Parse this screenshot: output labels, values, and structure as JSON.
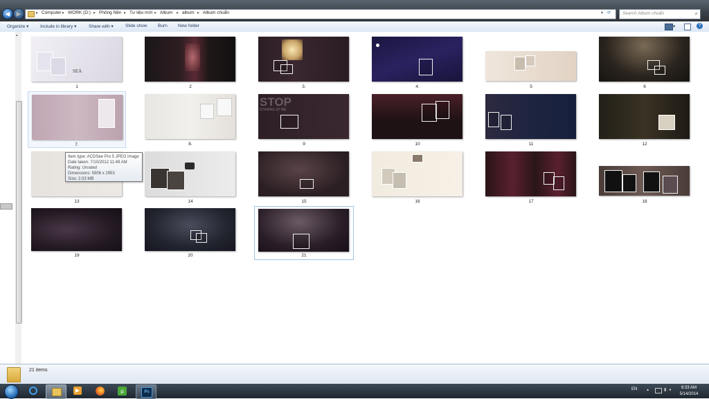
{
  "address": {
    "crumbs": [
      "Computer",
      "WORK (D:)",
      "Phông Nền",
      "Tư liệu mới",
      "Album",
      "album",
      "Album chuẩn"
    ]
  },
  "search": {
    "placeholder": "Search Album chuẩn"
  },
  "toolbar": {
    "organize": "Organize ▾",
    "include": "Include in library ▾",
    "share": "Share with ▾",
    "slideshow": "Slide show",
    "burn": "Burn",
    "newfolder": "New folder"
  },
  "files": [
    {
      "name": "1"
    },
    {
      "name": "2"
    },
    {
      "name": "3."
    },
    {
      "name": "4."
    },
    {
      "name": "5"
    },
    {
      "name": "6"
    },
    {
      "name": "7."
    },
    {
      "name": "8."
    },
    {
      "name": "9"
    },
    {
      "name": "10"
    },
    {
      "name": "11"
    },
    {
      "name": "12"
    },
    {
      "name": "13"
    },
    {
      "name": "14"
    },
    {
      "name": "15"
    },
    {
      "name": "16"
    },
    {
      "name": "17"
    },
    {
      "name": "18"
    },
    {
      "name": "19"
    },
    {
      "name": "20"
    },
    {
      "name": "21"
    }
  ],
  "thumb_texts": {
    "sea": "SEA",
    "stop": "STOP",
    "staring": "STARING AT ME"
  },
  "tooltip": {
    "type": "Item type: ACDSee Pro 5 JPEG Image",
    "date": "Date taken: 7/10/2012 11:49 AM",
    "rating": "Rating: Unrated",
    "dims": "Dimensions: 5906 x 2953",
    "size": "Size: 2.03 MB"
  },
  "status": {
    "count": "21 items"
  },
  "tray": {
    "lang": "EN",
    "time": "8:33 AM",
    "date": "5/14/2014"
  },
  "colors": {
    "accent": "#2c6fb8"
  }
}
